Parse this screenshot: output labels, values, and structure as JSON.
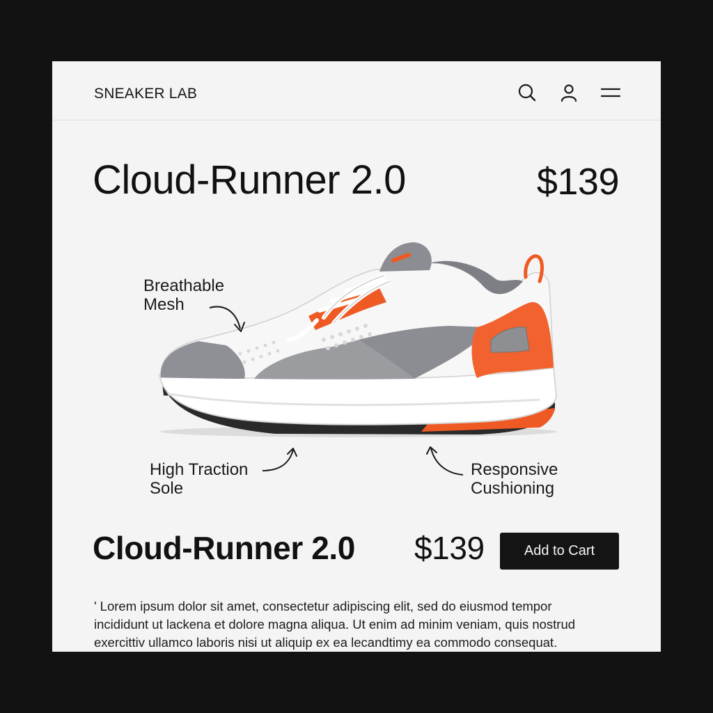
{
  "header": {
    "brand": "SNEAKER LAB",
    "icons": [
      "search-icon",
      "user-icon",
      "menu-icon"
    ]
  },
  "product": {
    "title": "Cloud-Runner 2.0",
    "price": "$139",
    "image_icon": "sneaker-image"
  },
  "annotations": {
    "mesh": {
      "line1": "Breathable",
      "line2": "Mesh"
    },
    "sole": {
      "line1": "High Traction",
      "line2": "Sole"
    },
    "cushion": {
      "line1": "Responsive",
      "line2": "Cushioning"
    }
  },
  "purchase": {
    "title": "Cloud-Runner 2.0",
    "price": "$139",
    "add_to_cart_label": "Add to Cart"
  },
  "description": "' Lorem ipsum dolor sit amet, consectetur adipiscing elit, sed do eiusmod tempor incididunt ut lackena et dolore magna aliqua. Ut enim ad minim veniam, quis nostrud exercittiv ullamco laboris nisi ut aliquip ex ea lecandtimy ea commodo consequat.",
  "colors": {
    "page_background": "#121212",
    "card_background": "#f4f4f4",
    "accent_orange": "#f2622e",
    "shoe_grey": "#8d8f93",
    "button_background": "#141414"
  }
}
